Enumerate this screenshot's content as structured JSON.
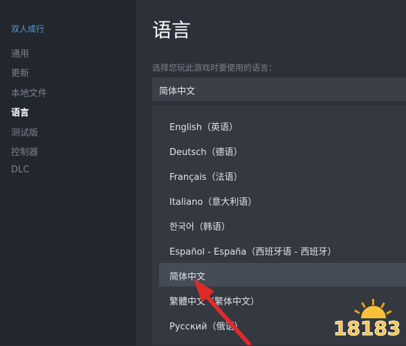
{
  "sidebar": {
    "game_title": "双人成行",
    "items": [
      {
        "label": "通用"
      },
      {
        "label": "更新"
      },
      {
        "label": "本地文件"
      },
      {
        "label": "语言"
      },
      {
        "label": "测试版"
      },
      {
        "label": "控制器"
      },
      {
        "label": "DLC"
      }
    ]
  },
  "main": {
    "title": "语言",
    "prompt": "选择您玩此游戏时要使用的语言：",
    "selected_language": "简体中文",
    "options": [
      {
        "label": "English（英语）"
      },
      {
        "label": "Deutsch（德语）"
      },
      {
        "label": "Français（法语）"
      },
      {
        "label": "Italiano（意大利语）"
      },
      {
        "label": "한국어（韩语）"
      },
      {
        "label": "Español - España（西班牙语 - 西班牙）"
      },
      {
        "label": "简体中文"
      },
      {
        "label": "繁體中文（繁体中文）"
      },
      {
        "label": "Русский（俄语）"
      }
    ],
    "hovered_option": "简体中文"
  },
  "watermark": {
    "text": "18183"
  },
  "colors": {
    "sidebar_bg": "#22262d",
    "main_bg": "#2c3039",
    "dropdown_bg": "#34383f",
    "hover_bg": "#464c56",
    "accent_blue": "#5e9bd1",
    "annotation_red": "#e02a2a"
  }
}
